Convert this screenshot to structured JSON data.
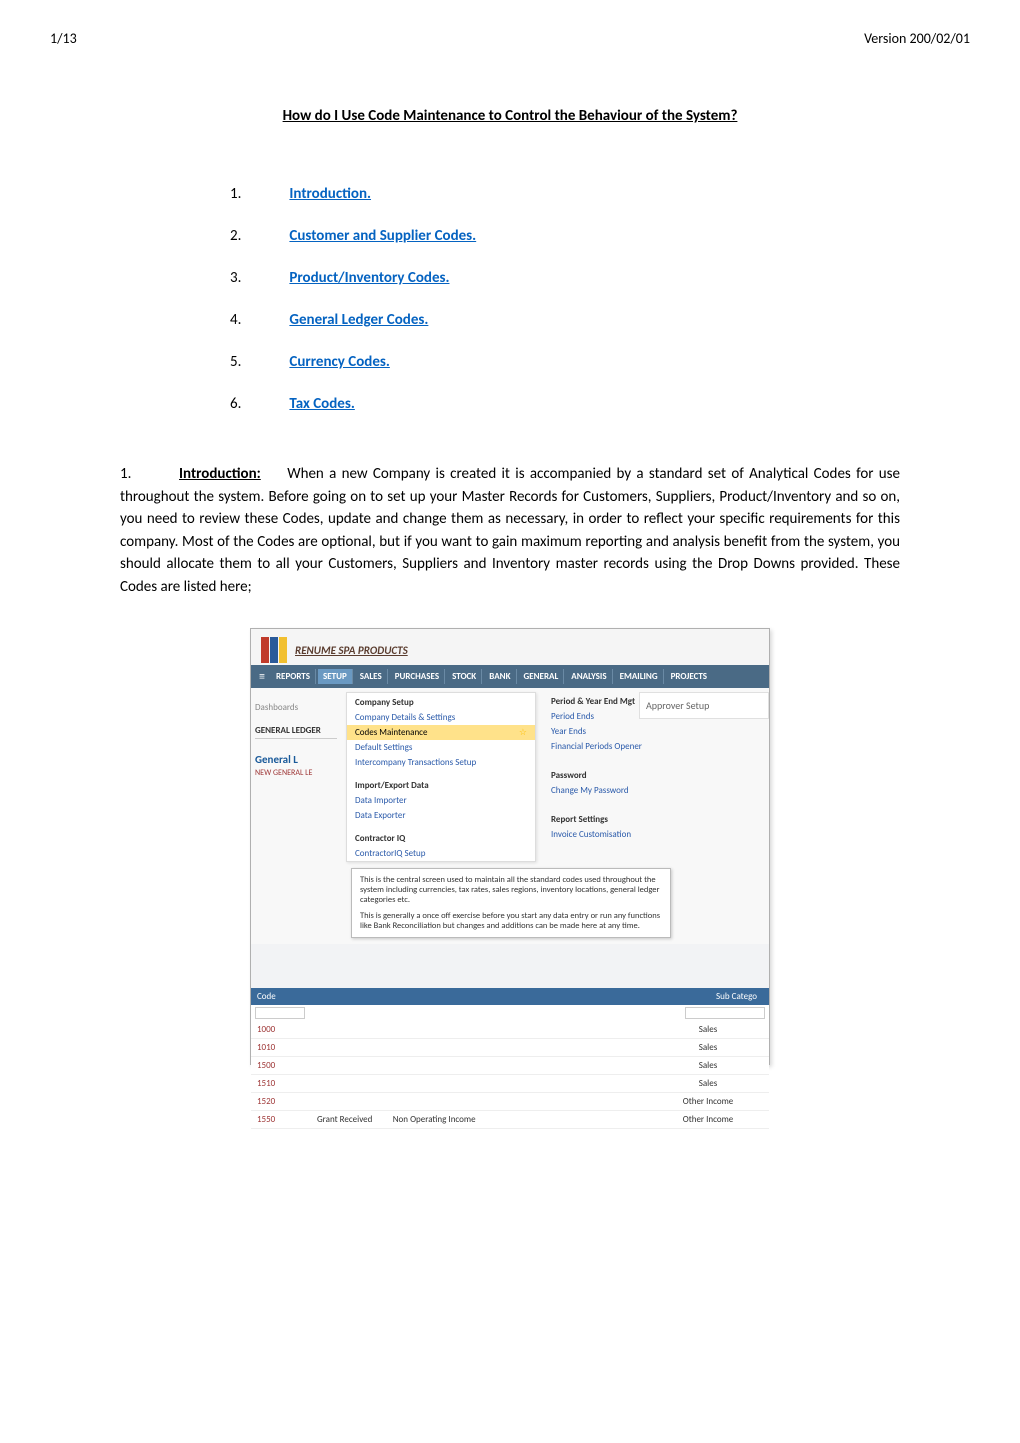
{
  "header": {
    "page_num": "1/13",
    "version": "Version 200/02/01"
  },
  "title": "How do I Use Code Maintenance to Control the Behaviour of the System?",
  "toc": [
    {
      "num": "1.",
      "label": "Introduction."
    },
    {
      "num": "2.",
      "label": "Customer and Supplier Codes."
    },
    {
      "num": "3.",
      "label": "Product/Inventory Codes."
    },
    {
      "num": "4.",
      "label": "General Ledger Codes."
    },
    {
      "num": "5.",
      "label": "Currency Codes."
    },
    {
      "num": "6.",
      "label": "Tax Codes."
    }
  ],
  "intro": {
    "num": "1.",
    "label": "Introduction:",
    "text": "When a new Company is created it is accompanied by a standard set of Analytical Codes for use throughout the system.  Before going on to set up your Master Records for Customers, Suppliers, Product/Inventory and so on, you need to review these Codes, update and change them as necessary, in order to reflect your specific requirements for this company.  Most of the Codes are optional, but if you want to gain maximum reporting and analysis benefit from the system, you should allocate them to all your Customers, Suppliers and Inventory master records using the Drop Downs provided.  These Codes are listed here;"
  },
  "screenshot": {
    "brand": "RENUME SPA PRODUCTS",
    "nav": [
      "REPORTS",
      "SETUP",
      "SALES",
      "PURCHASES",
      "STOCK",
      "BANK",
      "GENERAL",
      "ANALYSIS",
      "EMAILING",
      "PROJECTS"
    ],
    "nav_active_index": 1,
    "left": {
      "dashboards": "Dashboards",
      "gl_label": "GENERAL LEDGER",
      "gl_head": "General L",
      "gl_sub": "NEW GENERAL LE"
    },
    "dropdown_col1": {
      "heading1": "Company Setup",
      "links1": [
        "Company Details & Settings",
        "Codes Maintenance",
        "Default Settings",
        "Intercompany Transactions Setup"
      ],
      "highlight_index": 1,
      "heading2": "Import/Export Data",
      "links2": [
        "Data Importer",
        "Data Exporter"
      ],
      "heading3": "Contractor IQ",
      "links3": [
        "ContractorIQ Setup"
      ]
    },
    "dropdown_col2": {
      "heading1": "Period & Year End Mgt",
      "links1": [
        "Period Ends",
        "Year Ends",
        "Financial Periods Opener"
      ],
      "heading2": "Password",
      "links2": [
        "Change My Password"
      ],
      "heading3": "Report Settings",
      "links3": [
        "Invoice Customisation"
      ]
    },
    "approver": "Approver Setup",
    "tooltip_p1": "This is the central screen used to maintain all the standard codes used throughout the system including currencies, tax rates, sales regions, inventory locations, general ledger categories etc.",
    "tooltip_p2": "This is generally a once off exercise before you start any data entry or run any functions like Bank Reconciliation but changes and additions can be made here at any time.",
    "table": {
      "header_code": "Code",
      "header_sub": "Sub Catego",
      "rows": [
        {
          "code": "1000",
          "desc": "",
          "cat": "Sales"
        },
        {
          "code": "1010",
          "desc": "",
          "cat": "Sales"
        },
        {
          "code": "1500",
          "desc": "",
          "cat": "Sales"
        },
        {
          "code": "1510",
          "desc": "",
          "cat": "Sales"
        },
        {
          "code": "1520",
          "desc": "",
          "cat": "Other Income"
        },
        {
          "code": "1550",
          "desc": "Grant Received",
          "desc2": "Non Operating Income",
          "cat": "Other Income"
        }
      ]
    }
  }
}
